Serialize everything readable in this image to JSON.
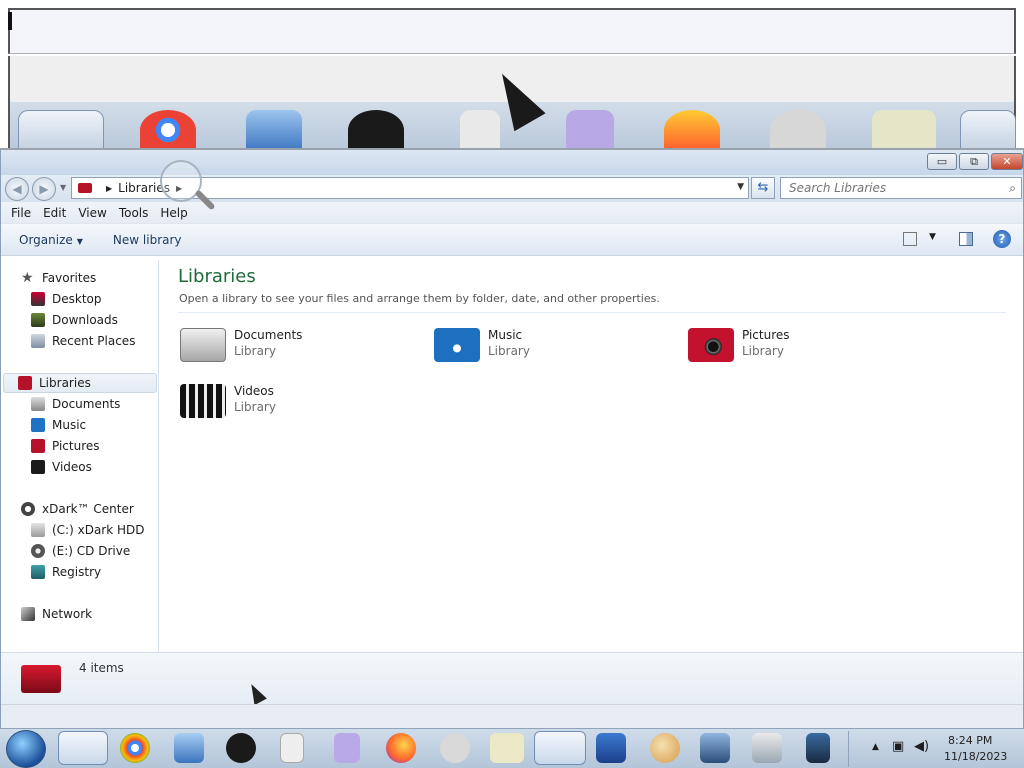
{
  "window": {
    "address_crumb": "Libraries",
    "search_placeholder": "Search Libraries",
    "menu": [
      "File",
      "Edit",
      "View",
      "Tools",
      "Help"
    ],
    "commands": {
      "organize": "Organize",
      "new_library": "New library"
    },
    "caption": {
      "minimize": "▭",
      "maximize": "⧉",
      "close": "✕"
    }
  },
  "nav": {
    "favorites": {
      "label": "Favorites",
      "items": [
        "Desktop",
        "Downloads",
        "Recent Places"
      ]
    },
    "libraries": {
      "label": "Libraries",
      "items": [
        "Documents",
        "Music",
        "Pictures",
        "Videos"
      ]
    },
    "computer": {
      "label": "xDark™ Center",
      "items": [
        "(C:) xDark HDD",
        "(E:) CD Drive",
        "Registry"
      ]
    },
    "network": {
      "label": "Network"
    }
  },
  "content": {
    "title": "Libraries",
    "subtitle": "Open a library to see your files and arrange them by folder, date, and other properties.",
    "libraries": [
      {
        "name": "Documents",
        "type": "Library"
      },
      {
        "name": "Music",
        "type": "Library"
      },
      {
        "name": "Pictures",
        "type": "Library"
      },
      {
        "name": "Videos",
        "type": "Library"
      }
    ]
  },
  "details": {
    "count": "4 items"
  },
  "taskbar": {
    "time": "8:24 PM",
    "date": "11/18/2023"
  },
  "colors": {
    "title_green": "#1e6b3a",
    "library_red": "#b5122a",
    "accent_blue": "#2f67b0"
  }
}
